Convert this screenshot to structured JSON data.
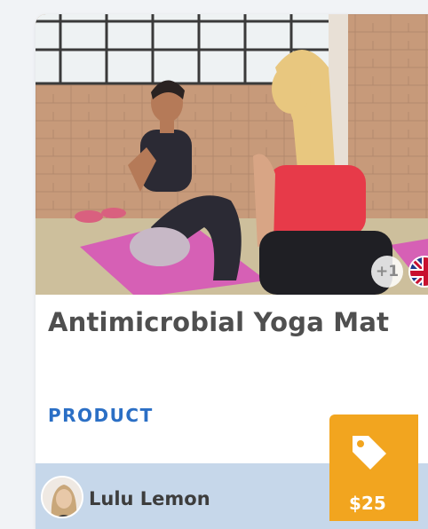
{
  "card": {
    "title": "Antimicrobial Yoga Mat",
    "category": "PRODUCT",
    "extra_count": "+1",
    "author_name": "Lulu Lemon",
    "price": "$25",
    "icons": {
      "flag": "uk-flag-icon",
      "tag": "price-tag-icon"
    }
  },
  "colors": {
    "title": "#4f4f4f",
    "category": "#2b6fc5",
    "footer_bg": "#c6d7ea",
    "price_bg": "#f2a51f"
  }
}
